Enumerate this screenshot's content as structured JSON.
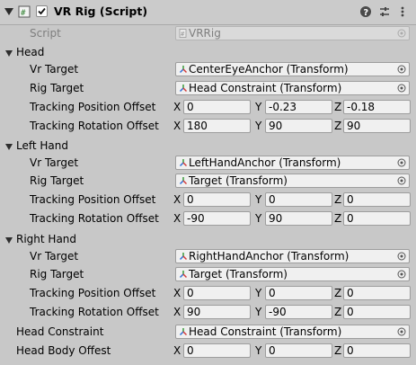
{
  "component": {
    "title": "VR Rig (Script)",
    "enabled": true,
    "script_label": "Script",
    "script_value": "VRRig"
  },
  "labels": {
    "vr_target": "Vr Target",
    "rig_target": "Rig Target",
    "tracking_position_offset": "Tracking Position Offset",
    "tracking_rotation_offset": "Tracking Rotation Offset",
    "x": "X",
    "y": "Y",
    "z": "Z"
  },
  "head": {
    "label": "Head",
    "vr_target": "CenterEyeAnchor (Transform)",
    "rig_target": "Head Constraint (Transform)",
    "position_offset": {
      "x": "0",
      "y": "-0.23",
      "z": "-0.18"
    },
    "rotation_offset": {
      "x": "180",
      "y": "90",
      "z": "90"
    }
  },
  "left_hand": {
    "label": "Left Hand",
    "vr_target": "LeftHandAnchor (Transform)",
    "rig_target": "Target (Transform)",
    "position_offset": {
      "x": "0",
      "y": "0",
      "z": "0"
    },
    "rotation_offset": {
      "x": "-90",
      "y": "90",
      "z": "0"
    }
  },
  "right_hand": {
    "label": "Right Hand",
    "vr_target": "RightHandAnchor (Transform)",
    "rig_target": "Target (Transform)",
    "position_offset": {
      "x": "0",
      "y": "0",
      "z": "0"
    },
    "rotation_offset": {
      "x": "90",
      "y": "-90",
      "z": "0"
    }
  },
  "head_constraint": {
    "label": "Head Constraint",
    "value": "Head Constraint (Transform)"
  },
  "head_body_offset": {
    "label": "Head Body Offest",
    "value": {
      "x": "0",
      "y": "0",
      "z": "0"
    }
  },
  "icons": {
    "header": [
      "help-icon",
      "presets-icon",
      "context-menu-icon"
    ],
    "transform": "transform-icon",
    "picker": "object-picker-icon"
  }
}
